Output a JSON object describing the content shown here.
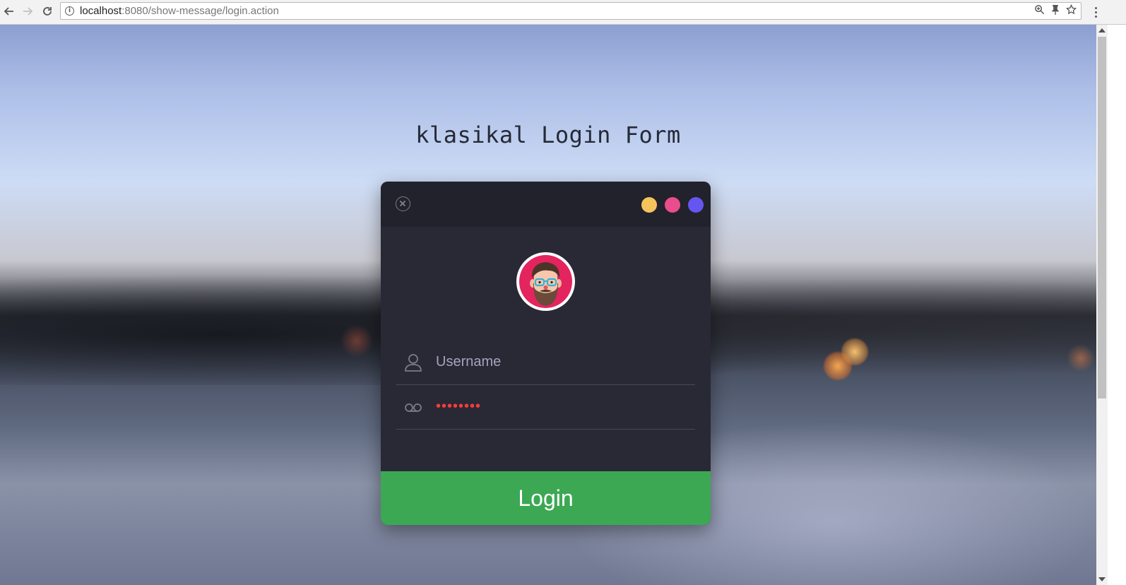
{
  "browser": {
    "url_host": "localhost",
    "url_rest": ":8080/show-message/login.action",
    "back_icon": "back-arrow-icon",
    "forward_icon": "forward-arrow-icon",
    "reload_icon": "reload-icon",
    "page_info_icon": "info-icon",
    "zoom_icon": "zoom-icon",
    "extension_icon": "pin-icon",
    "bookmark_icon": "star-icon",
    "menu_icon": "kebab-menu-icon"
  },
  "page": {
    "title": "klasikal Login Form"
  },
  "card": {
    "close_icon": "close-icon",
    "dots": [
      {
        "color": "#f5c35b"
      },
      {
        "color": "#ea4d8e"
      },
      {
        "color": "#6656f0"
      }
    ],
    "avatar_icon": "avatar-icon",
    "username": {
      "icon": "user-icon",
      "placeholder": "Username",
      "value": ""
    },
    "password": {
      "icon": "voicemail-icon",
      "value": "••••••••"
    },
    "login_label": "Login",
    "login_color": "#3ca854",
    "card_color": "#292935"
  }
}
